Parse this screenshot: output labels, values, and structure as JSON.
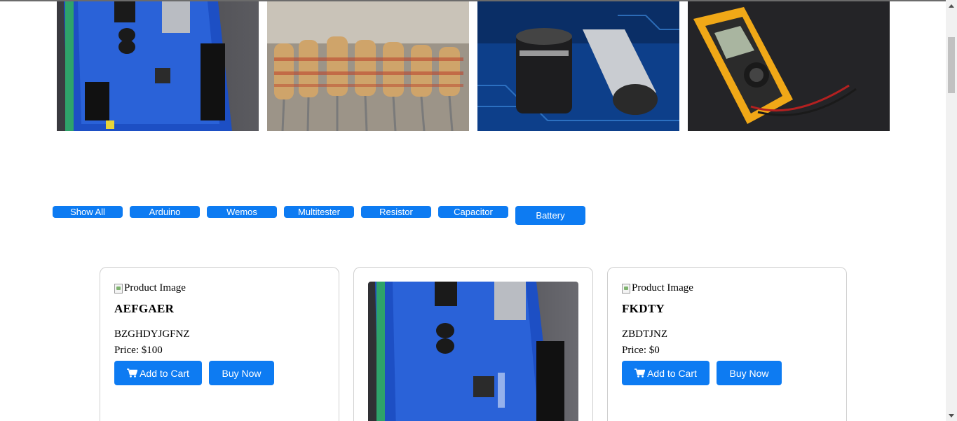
{
  "banner": {
    "images": [
      {
        "icon": "arduino-board-photo"
      },
      {
        "icon": "resistors-photo"
      },
      {
        "icon": "capacitors-photo"
      },
      {
        "icon": "multimeter-photo"
      }
    ]
  },
  "filters": {
    "buttons": [
      "Show All",
      "Arduino",
      "Wemos",
      "Multitester",
      "Resistor",
      "Capacitor",
      "Battery"
    ]
  },
  "products": [
    {
      "image_alt": "Product Image",
      "name": "AEFGAER",
      "description": "BZGHDYJGFNZ",
      "price": "Price: $100",
      "add_to_cart": "Add to Cart",
      "buy_now": "Buy Now"
    },
    {
      "image": "arduino-board-photo"
    },
    {
      "image_alt": "Product Image",
      "name": "FKDTY",
      "description": "ZBDTJNZ",
      "price": "Price: $0",
      "add_to_cart": "Add to Cart",
      "buy_now": "Buy Now"
    }
  ],
  "colors": {
    "accent": "#0d7bf2",
    "card_border": "#cfcfcf"
  }
}
